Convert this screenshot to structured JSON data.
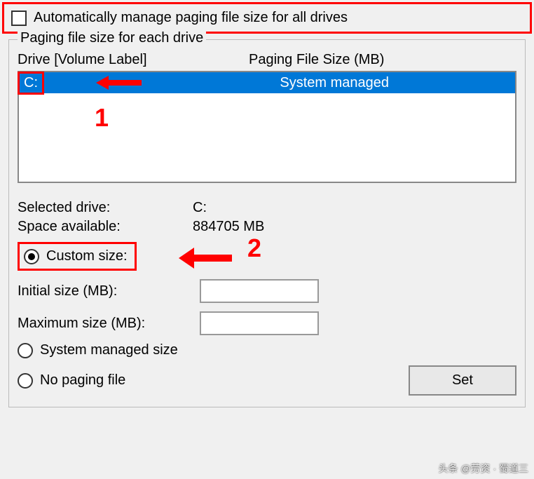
{
  "auto_manage_label": "Automatically manage paging file size for all drives",
  "group_title": "Paging file size for each drive",
  "headers": {
    "drive": "Drive  [Volume Label]",
    "size": "Paging File Size (MB)"
  },
  "drive_list": {
    "selected_drive": "C:",
    "selected_size": "System managed"
  },
  "annotations": {
    "num1": "1",
    "num2": "2"
  },
  "info": {
    "selected_drive_label": "Selected drive:",
    "selected_drive_value": "C:",
    "space_label": "Space available:",
    "space_value": "884705 MB"
  },
  "radios": {
    "custom": "Custom size:",
    "system": "System managed size",
    "none": "No paging file"
  },
  "size_inputs": {
    "initial": "Initial size (MB):",
    "maximum": "Maximum size (MB):"
  },
  "set_button": "Set",
  "watermark": "头条 @劳资 · 蜀道三"
}
